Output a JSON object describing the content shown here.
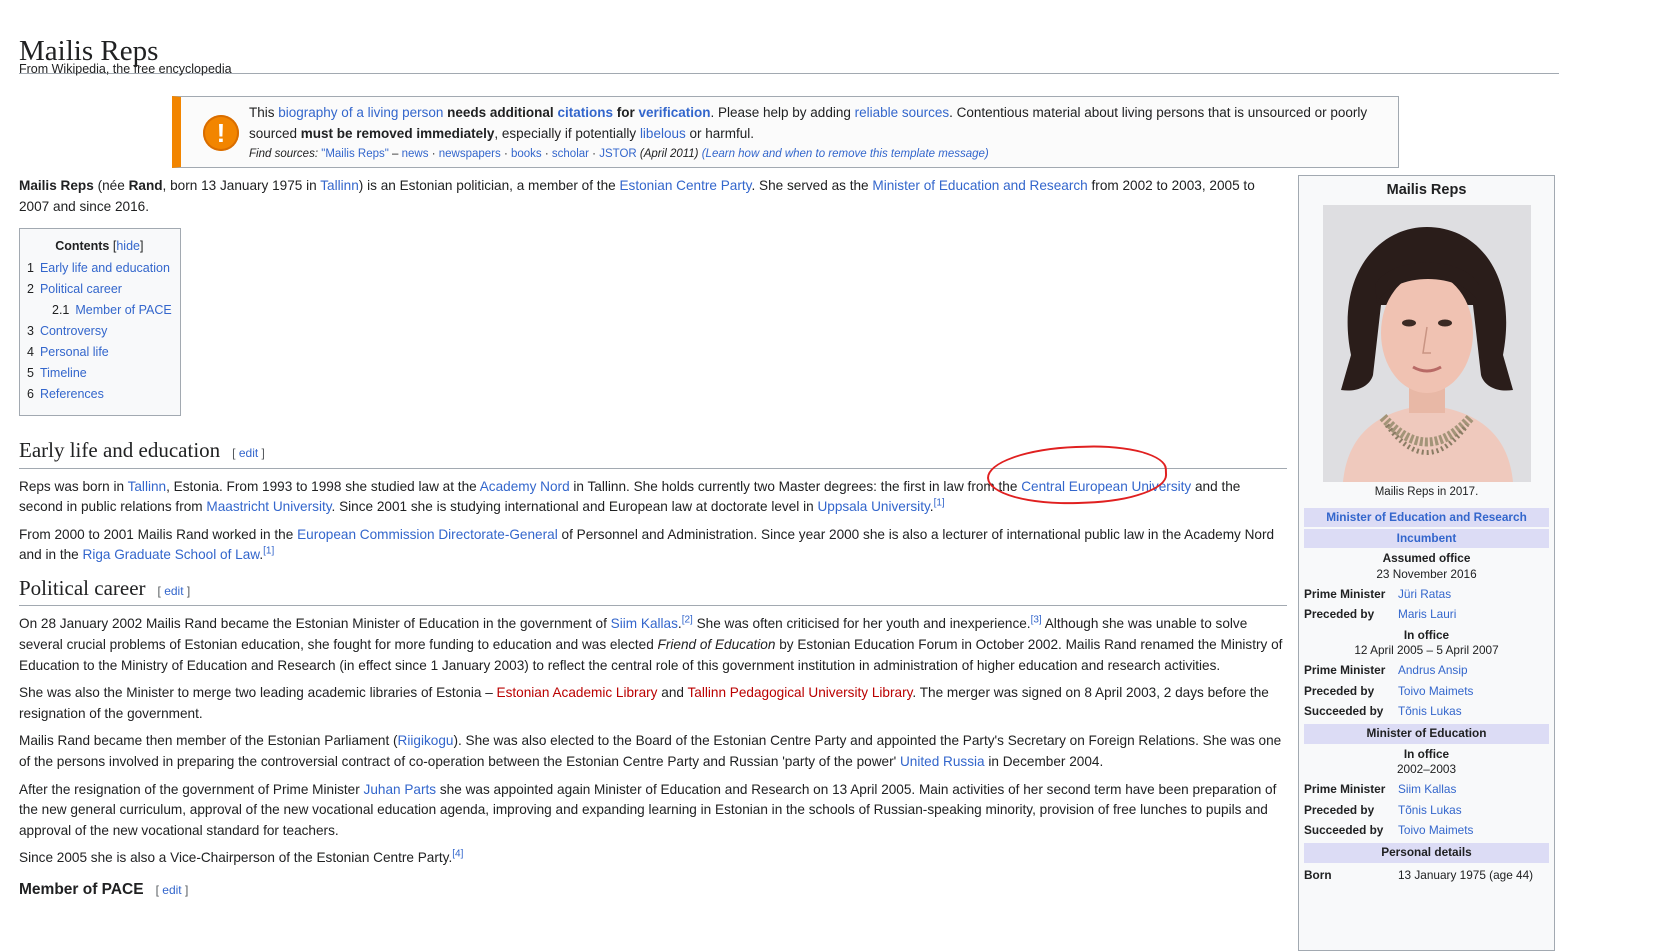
{
  "page": {
    "title": "Mailis Reps",
    "tagline": "From Wikipedia, the free encyclopedia"
  },
  "ambox": {
    "t1": "This ",
    "l1": "biography of a living person",
    "t2": " ",
    "b1": "needs additional",
    "t3": " ",
    "l2": "citations",
    "b2": " for ",
    "l3": "verification",
    "t4": ". Please help by adding ",
    "l4": "reliable sources",
    "t5": ". Contentious material about living persons that is unsourced or poorly sourced ",
    "b3": "must be removed immediately",
    "t6": ", especially if potentially ",
    "l5": "libelous",
    "t7": " or harmful.",
    "find_sources": "Find sources:",
    "fs_query": "\"Mailis Reps\"",
    "fs_dash": " – ",
    "fs_news": "news",
    "fs_newspapers": "newspapers",
    "fs_books": "books",
    "fs_scholar": "scholar",
    "fs_jstor": "JSTOR",
    "sep": " · ",
    "date": " (April 2011)",
    "learn": "(Learn how and when to remove this template message)"
  },
  "lead": {
    "b1": "Mailis Reps",
    "t1": " (née ",
    "b2": "Rand",
    "t2": ", born 13 January 1975 in ",
    "l1": "Tallinn",
    "t3": ") is an Estonian politician, a member of the ",
    "l2": "Estonian Centre Party",
    "t4": ". She served as the ",
    "l3": "Minister of Education and Research",
    "t5": " from 2002 to 2003, 2005 to 2007 and since 2016."
  },
  "toc": {
    "title": "Contents",
    "toggle": "hide",
    "items": [
      {
        "num": "1",
        "label": "Early life and education"
      },
      {
        "num": "2",
        "label": "Political career"
      },
      {
        "num": "2.1",
        "label": "Member of PACE"
      },
      {
        "num": "3",
        "label": "Controversy"
      },
      {
        "num": "4",
        "label": "Personal life"
      },
      {
        "num": "5",
        "label": "Timeline"
      },
      {
        "num": "6",
        "label": "References"
      }
    ]
  },
  "edit_label": "edit",
  "early": {
    "heading": "Early life and education",
    "p1": {
      "t1": "Reps was born in ",
      "l1": "Tallinn",
      "t2": ", Estonia. From 1993 to 1998 she studied law at the ",
      "l2": "Academy Nord",
      "t3": " in Tallinn. She holds currently two Master degrees: the first in law from the ",
      "l3": "Central European University",
      "t4": " and the second in public relations from ",
      "l4": "Maastricht University",
      "t5": ". Since 2001 she is studying international and European law at doctorate level in ",
      "l5": "Uppsala University",
      "t6": ".",
      "ref1": "[1]"
    },
    "p2": {
      "t1": "From 2000 to 2001 Mailis Rand worked in the ",
      "l1": "European Commission Directorate-General",
      "t2": " of Personnel and Administration. Since year 2000 she is also a lecturer of international public law in the Academy Nord and in the ",
      "l2": "Riga Graduate School of Law",
      "t3": ".",
      "ref1": "[1]"
    }
  },
  "political": {
    "heading": "Political career",
    "p1": {
      "t1": "On 28 January 2002 Mailis Rand became the Estonian Minister of Education in the government of ",
      "l1": "Siim Kallas",
      "t2": ".",
      "ref2": "[2]",
      "t3": " She was often criticised for her youth and inexperience.",
      "ref3": "[3]",
      "t4": " Although she was unable to solve several crucial problems of Estonian education, she fought for more funding to education and was elected ",
      "i1": "Friend of Education",
      "t5": " by Estonian Education Forum in October 2002. Mailis Rand renamed the Ministry of Education to the Ministry of Education and Research (in effect since 1 January 2003) to reflect the central role of this government institution in administration of higher education and research activities."
    },
    "p2": {
      "t1": "She was also the Minister to merge two leading academic libraries of Estonia – ",
      "r1": "Estonian Academic Library",
      "t2": " and ",
      "r2": "Tallinn Pedagogical University Library",
      "t3": ". The merger was signed on 8 April 2003, 2 days before the resignation of the government."
    },
    "p3": {
      "t1": "Mailis Rand became then member of the Estonian Parliament (",
      "l1": "Riigikogu",
      "t2": "). She was also elected to the Board of the Estonian Centre Party and appointed the Party's Secretary on Foreign Relations. She was one of the persons involved in preparing the controversial contract of co-operation between the Estonian Centre Party and Russian 'party of the power' ",
      "l2": "United Russia",
      "t3": " in December 2004."
    },
    "p4": {
      "t1": "After the resignation of the government of Prime Minister ",
      "l1": "Juhan Parts",
      "t2": " she was appointed again Minister of Education and Research on 13 April 2005. Main activities of her second term have been preparation of the new general curriculum, approval of the new vocational education agenda, improving and expanding learning in Estonian in the schools of Russian-speaking minority, provision of free lunches to pupils and approval of the new vocational standard for teachers."
    },
    "p5": {
      "t1": "Since 2005 she is also a Vice-Chairperson of the Estonian Centre Party.",
      "ref4": "[4]"
    }
  },
  "pace": {
    "heading": "Member of PACE"
  },
  "infobox": {
    "title": "Mailis Reps",
    "caption": "Mailis Reps in 2017.",
    "office1": "Minister of Education and Research",
    "incumbent": "Incumbent",
    "assumed_label": "Assumed office",
    "assumed_date": "23 November 2016",
    "pm_label": "Prime Minister",
    "preceded_label": "Preceded by",
    "succeeded_label": "Succeeded by",
    "t1_pm": "Jüri Ratas",
    "t1_prev": "Maris Lauri",
    "in_office_label": "In office",
    "t2_dates": "12 April 2005 – 5 April 2007",
    "t2_pm": "Andrus Ansip",
    "t2_prev": "Toivo Maimets",
    "t2_next": "Tõnis Lukas",
    "office2": "Minister of Education",
    "t3_dates": "2002–2003",
    "t3_pm": "Siim Kallas",
    "t3_prev": "Tõnis Lukas",
    "t3_next": "Toivo Maimets",
    "personal": "Personal details",
    "born_label": "Born",
    "born_value": "13 January 1975 (age 44)"
  },
  "colors": {
    "link": "#3366cc",
    "redlink": "#ba0000",
    "ambox_accent": "#f28500",
    "annotation": "#e02020"
  }
}
